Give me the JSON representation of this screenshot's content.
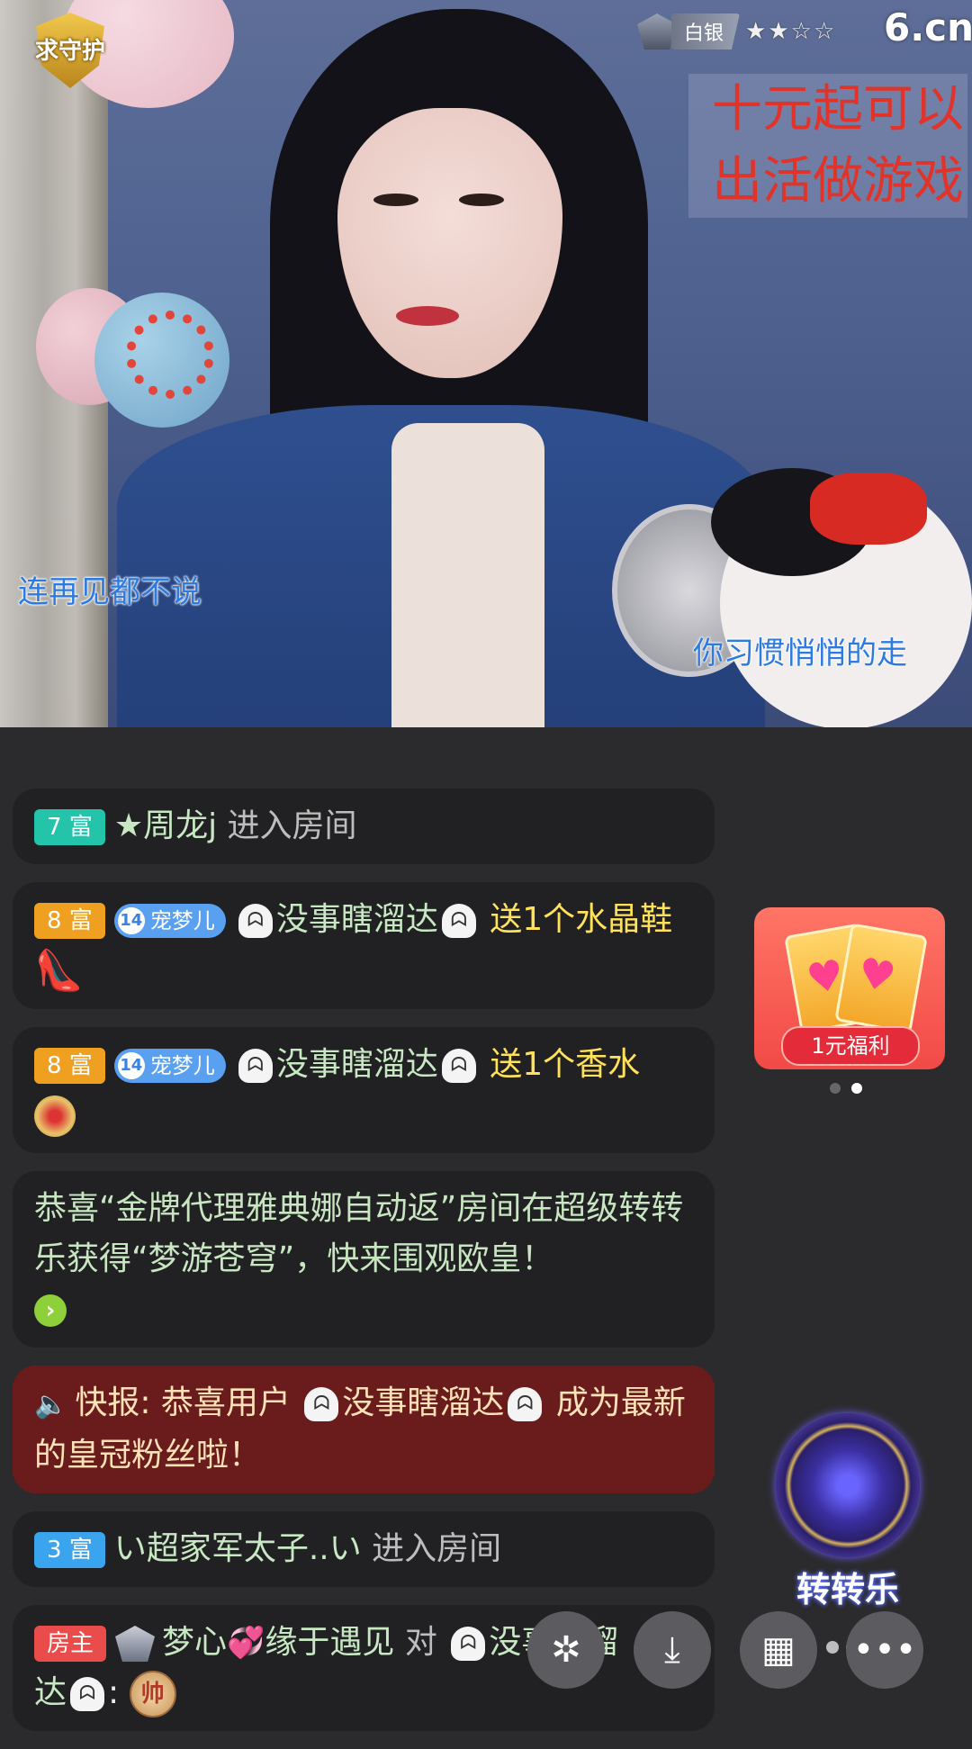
{
  "stream": {
    "guard_badge": "求守护",
    "rank_label": "白银",
    "stars": "★★☆☆",
    "logo": "6.cn",
    "promo_line1": "十元起可以",
    "promo_line2": "出活做游戏",
    "lyric_left": "连再见都不说",
    "lyric_right": "你习惯悄悄的走"
  },
  "chat": {
    "m1": {
      "badge": "7 富",
      "name": "★周龙j",
      "action": "进入房间"
    },
    "m2": {
      "badge": "8 富",
      "fan_level": "14",
      "fan_name": "宠梦儿",
      "ghost": "ᗣ",
      "user": "没事瞎溜达",
      "gift": "送1个水晶鞋",
      "gift_icon": "👠"
    },
    "m3": {
      "badge": "8 富",
      "fan_level": "14",
      "fan_name": "宠梦儿",
      "ghost": "ᗣ",
      "user": "没事瞎溜达",
      "gift": "送1个香水"
    },
    "m4": {
      "text": "恭喜“金牌代理雅典娜自动返”房间在超级转转乐获得“梦游苍穹”，快来围观欧皇！",
      "go": "›"
    },
    "m5": {
      "prefix": "快报: 恭喜用户",
      "user": "没事瞎溜达",
      "suffix": "成为最新的皇冠粉丝啦！",
      "speaker": "🔈"
    },
    "m6": {
      "badge": "3 富",
      "name": "い超家军太子..い",
      "action": "进入房间"
    },
    "m7": {
      "badge": "房主",
      "name": "梦心",
      "heart": "💞",
      "name2": "缘于遇见",
      "to": "对",
      "user": "没事瞎溜",
      "user2": "达",
      "colon": ":",
      "emote": "帅"
    }
  },
  "widgets": {
    "welfare_label": "1元福利",
    "heart": "♥",
    "wheel_label": "转转乐"
  },
  "toolbar": {
    "share_icon": "✲",
    "save_icon": "⤓",
    "grid_icon": "▦",
    "more_icon": "•••"
  },
  "colors": {
    "accent": "#ffe25a",
    "flash_bg": "#6a1c1c"
  }
}
